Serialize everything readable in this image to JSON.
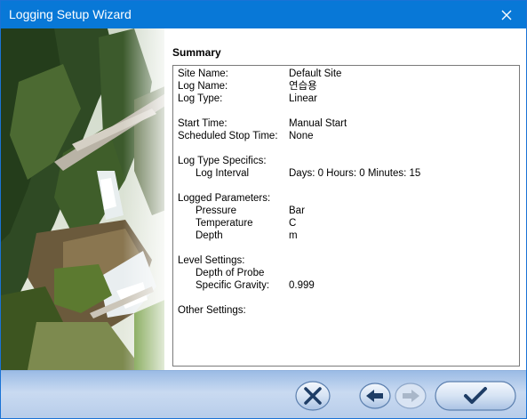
{
  "window": {
    "title": "Logging Setup Wizard"
  },
  "summary": {
    "heading": "Summary",
    "site_name_label": "Site Name:",
    "site_name_value": "Default Site",
    "log_name_label": "Log Name:",
    "log_name_value": "연습용",
    "log_type_label": "Log Type:",
    "log_type_value": "Linear",
    "start_time_label": "Start Time:",
    "start_time_value": "Manual Start",
    "stop_time_label": "Scheduled Stop Time:",
    "stop_time_value": "None",
    "log_type_specifics_label": "Log Type Specifics:",
    "log_interval_label": "Log Interval",
    "log_interval_value": "Days: 0 Hours: 0 Minutes: 15",
    "logged_parameters_label": "Logged Parameters:",
    "pressure_label": "Pressure",
    "pressure_value": "Bar",
    "temperature_label": "Temperature",
    "temperature_value": "C",
    "depth_label": "Depth",
    "depth_value": "m",
    "level_settings_label": "Level Settings:",
    "depth_of_probe_label": "Depth of Probe",
    "specific_gravity_label": "Specific Gravity:",
    "specific_gravity_value": "0.999",
    "other_settings_label": "Other Settings:"
  },
  "icons": {
    "close": "close-icon",
    "cancel": "x-icon",
    "back": "left-arrow-icon",
    "next": "right-arrow-icon",
    "finish": "checkmark-icon"
  },
  "colors": {
    "titlebar": "#0878d7",
    "footer": "#b8cdea"
  }
}
